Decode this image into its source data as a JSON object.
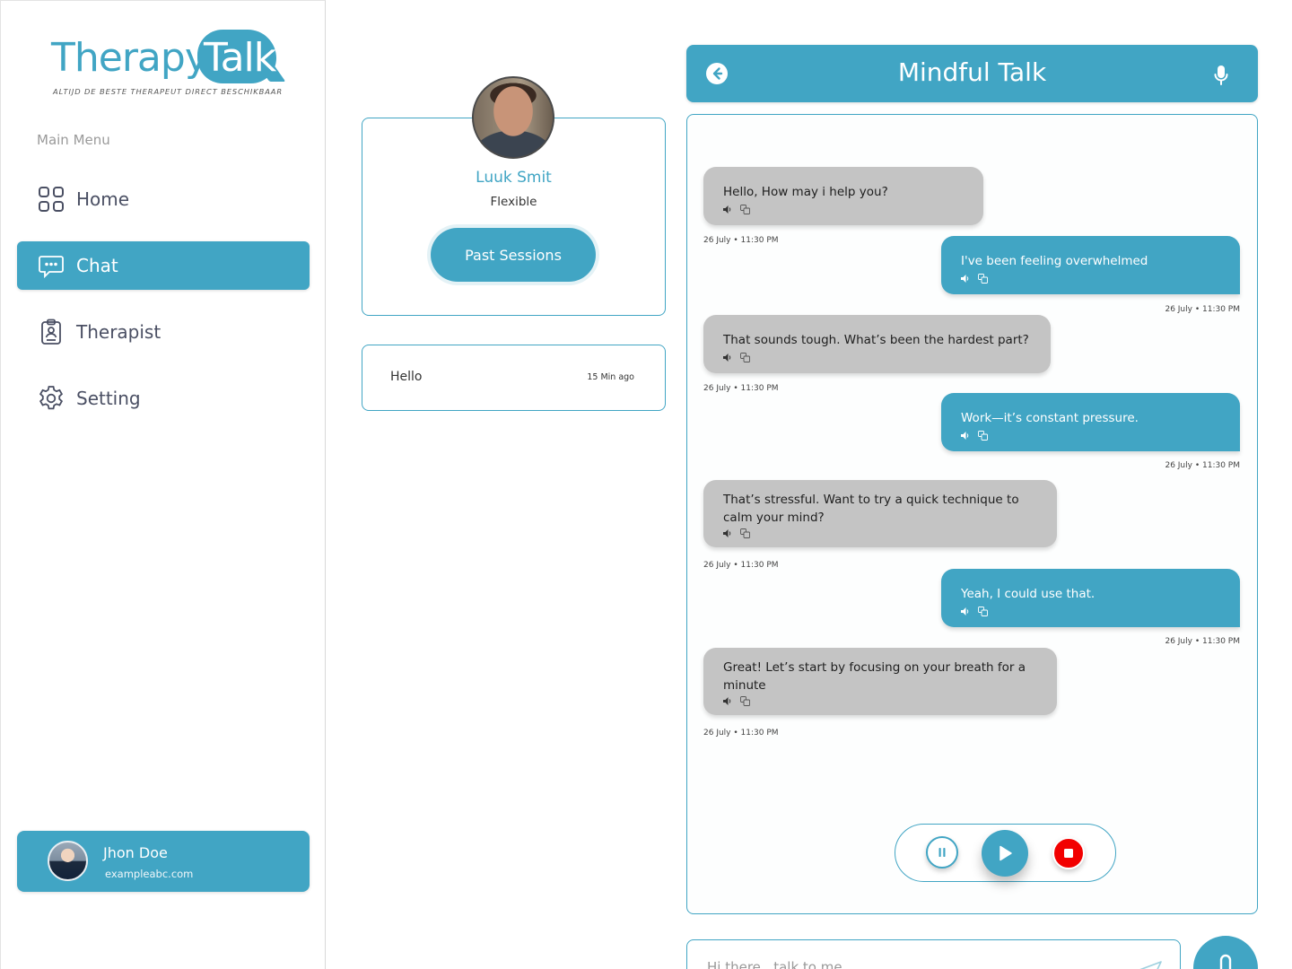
{
  "brand": {
    "name_part1": "Therapy",
    "name_part2": "Talk",
    "tagline": "ALTIJD DE BESTE THERAPEUT DIRECT BESCHIKBAAR"
  },
  "sidebar": {
    "menu_title": "Main Menu",
    "items": [
      {
        "label": "Home",
        "icon": "grid-icon"
      },
      {
        "label": "Chat",
        "icon": "chat-bubble-icon",
        "active": true
      },
      {
        "label": "Therapist",
        "icon": "clipboard-user-icon"
      },
      {
        "label": "Setting",
        "icon": "gear-icon"
      }
    ],
    "user": {
      "name": "Jhon Doe",
      "email": "exampleabc.com"
    }
  },
  "therapist": {
    "name": "Luuk Smit",
    "status": "Flexible",
    "past_sessions_label": "Past Sessions"
  },
  "sessions": [
    {
      "text": "Hello",
      "time": "15 Min ago"
    }
  ],
  "chat": {
    "title": "Mindful Talk",
    "messages": [
      {
        "sender": "therapist",
        "text": "Hello, How may i help you?",
        "time": "26 July • 11:30 PM"
      },
      {
        "sender": "user",
        "text": "I've been feeling overwhelmed",
        "time": "26 July • 11:30 PM"
      },
      {
        "sender": "therapist",
        "text": "That sounds tough. What’s been the hardest part?",
        "time": "26 July • 11:30 PM"
      },
      {
        "sender": "user",
        "text": "Work—it’s constant pressure.",
        "time": "26 July • 11:30 PM"
      },
      {
        "sender": "therapist",
        "text": "That’s stressful. Want to try a quick technique to\ncalm your mind?",
        "time": "26 July • 11:30 PM"
      },
      {
        "sender": "user",
        "text": "Yeah, I could use that.",
        "time": "26 July • 11:30 PM"
      },
      {
        "sender": "therapist",
        "text": "Great! Let’s start by focusing on your breath for a\nminute",
        "time": "26 July • 11:30 PM"
      }
    ],
    "input_placeholder": "Hi there.. talk to me"
  },
  "colors": {
    "accent": "#41a5c4",
    "incoming_bubble": "#c4c4c4",
    "stop": "#f20000"
  }
}
